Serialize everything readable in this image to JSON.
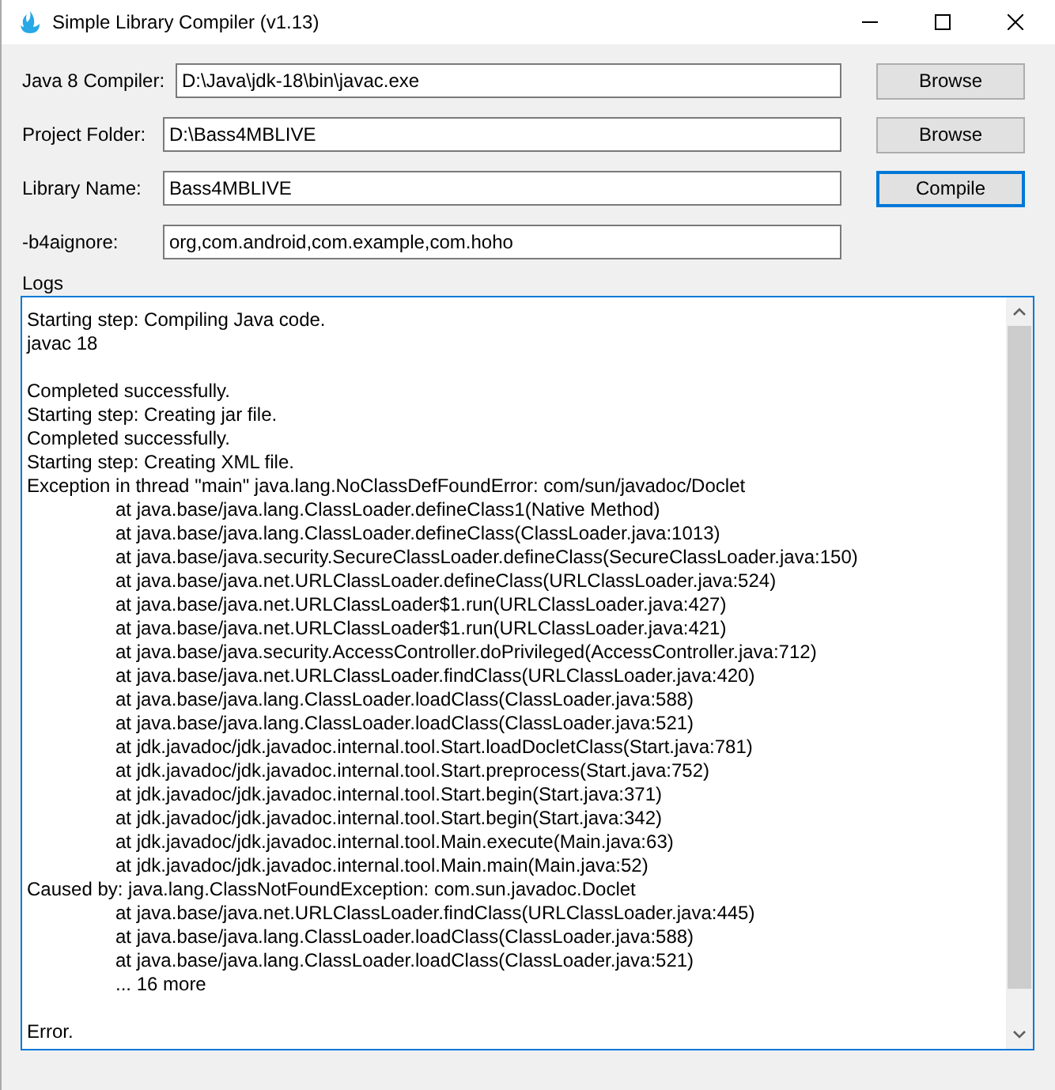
{
  "window": {
    "title": "Simple Library Compiler (v1.13)"
  },
  "fields": [
    {
      "label": "Java 8 Compiler:",
      "value": "D:\\Java\\jdk-18\\bin\\javac.exe",
      "button": {
        "label": "Browse",
        "focused": false
      }
    },
    {
      "label": "Project Folder:",
      "value": "D:\\Bass4MBLIVE",
      "button": {
        "label": "Browse",
        "focused": false
      }
    },
    {
      "label": "Library Name:",
      "value": "Bass4MBLIVE",
      "button": {
        "label": "Compile",
        "focused": true
      }
    },
    {
      "label": "-b4aignore:",
      "value": "org,com.android,com.example,com.hoho"
    }
  ],
  "logs": {
    "title": "Logs",
    "lines": [
      {
        "kind": "line",
        "text": "Starting step: Compiling Java code."
      },
      {
        "kind": "line",
        "text": "javac 18"
      },
      {
        "kind": "blank"
      },
      {
        "kind": "line",
        "text": "Completed successfully."
      },
      {
        "kind": "line",
        "text": "Starting step: Creating jar file."
      },
      {
        "kind": "line",
        "text": "Completed successfully."
      },
      {
        "kind": "line",
        "text": "Starting step: Creating XML file."
      },
      {
        "kind": "line",
        "text": "Exception in thread \"main\" java.lang.NoClassDefFoundError: com/sun/javadoc/Doclet"
      },
      {
        "kind": "indented",
        "text": "at java.base/java.lang.ClassLoader.defineClass1(Native Method)"
      },
      {
        "kind": "indented",
        "text": "at java.base/java.lang.ClassLoader.defineClass(ClassLoader.java:1013)"
      },
      {
        "kind": "indented",
        "text": "at java.base/java.security.SecureClassLoader.defineClass(SecureClassLoader.java:150)"
      },
      {
        "kind": "indented",
        "text": "at java.base/java.net.URLClassLoader.defineClass(URLClassLoader.java:524)"
      },
      {
        "kind": "indented",
        "text": "at java.base/java.net.URLClassLoader$1.run(URLClassLoader.java:427)"
      },
      {
        "kind": "indented",
        "text": "at java.base/java.net.URLClassLoader$1.run(URLClassLoader.java:421)"
      },
      {
        "kind": "indented",
        "text": "at java.base/java.security.AccessController.doPrivileged(AccessController.java:712)"
      },
      {
        "kind": "indented",
        "text": "at java.base/java.net.URLClassLoader.findClass(URLClassLoader.java:420)"
      },
      {
        "kind": "indented",
        "text": "at java.base/java.lang.ClassLoader.loadClass(ClassLoader.java:588)"
      },
      {
        "kind": "indented",
        "text": "at java.base/java.lang.ClassLoader.loadClass(ClassLoader.java:521)"
      },
      {
        "kind": "indented",
        "text": "at jdk.javadoc/jdk.javadoc.internal.tool.Start.loadDocletClass(Start.java:781)"
      },
      {
        "kind": "indented",
        "text": "at jdk.javadoc/jdk.javadoc.internal.tool.Start.preprocess(Start.java:752)"
      },
      {
        "kind": "indented",
        "text": "at jdk.javadoc/jdk.javadoc.internal.tool.Start.begin(Start.java:371)"
      },
      {
        "kind": "indented",
        "text": "at jdk.javadoc/jdk.javadoc.internal.tool.Start.begin(Start.java:342)"
      },
      {
        "kind": "indented",
        "text": "at jdk.javadoc/jdk.javadoc.internal.tool.Main.execute(Main.java:63)"
      },
      {
        "kind": "indented",
        "text": "at jdk.javadoc/jdk.javadoc.internal.tool.Main.main(Main.java:52)"
      },
      {
        "kind": "line",
        "text": "Caused by: java.lang.ClassNotFoundException: com.sun.javadoc.Doclet"
      },
      {
        "kind": "indented",
        "text": "at java.base/java.net.URLClassLoader.findClass(URLClassLoader.java:445)"
      },
      {
        "kind": "indented",
        "text": "at java.base/java.lang.ClassLoader.loadClass(ClassLoader.java:588)"
      },
      {
        "kind": "indented",
        "text": "at java.base/java.lang.ClassLoader.loadClass(ClassLoader.java:521)"
      },
      {
        "kind": "indented",
        "text": "... 16 more"
      },
      {
        "kind": "blank"
      },
      {
        "kind": "line",
        "text": "Error."
      }
    ]
  }
}
